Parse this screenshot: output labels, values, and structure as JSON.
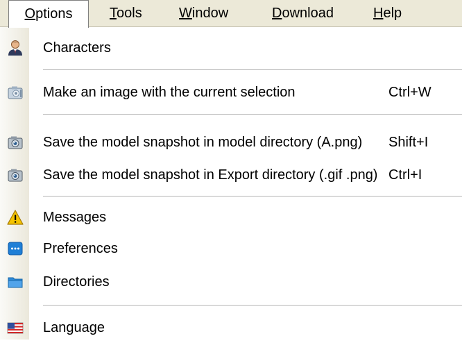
{
  "menubar": {
    "items": [
      {
        "underline": "O",
        "rest": "ptions"
      },
      {
        "underline": "T",
        "rest": "ools"
      },
      {
        "underline": "W",
        "rest": "indow"
      },
      {
        "underline": "D",
        "rest": "ownload"
      },
      {
        "underline": "H",
        "rest": "elp"
      }
    ],
    "active": "Options"
  },
  "menu": {
    "items": [
      {
        "label": "Characters",
        "icon": "user-icon"
      },
      {
        "label": "Make an image with the current selection",
        "shortcut": "Ctrl+W",
        "icon": "camera-icon"
      },
      {
        "label": "Save the model snapshot in model directory (A.png)",
        "shortcut": "Shift+I",
        "icon": "camera-icon"
      },
      {
        "label": "Save the model snapshot in Export directory (.gif .png)",
        "shortcut": "Ctrl+I",
        "icon": "camera-icon"
      },
      {
        "label": "Messages",
        "icon": "warning-icon"
      },
      {
        "label": "Preferences",
        "icon": "preferences-icon"
      },
      {
        "label": "Directories",
        "icon": "folder-icon"
      },
      {
        "label": "Language",
        "icon": "flag-icon"
      }
    ]
  },
  "colors": {
    "menubar_bg": "#ece9d8",
    "gutter": "#ebe8db",
    "separator": "#b4b4b4",
    "warning": "#f5c400",
    "prefs_blue": "#1f7fd6"
  }
}
